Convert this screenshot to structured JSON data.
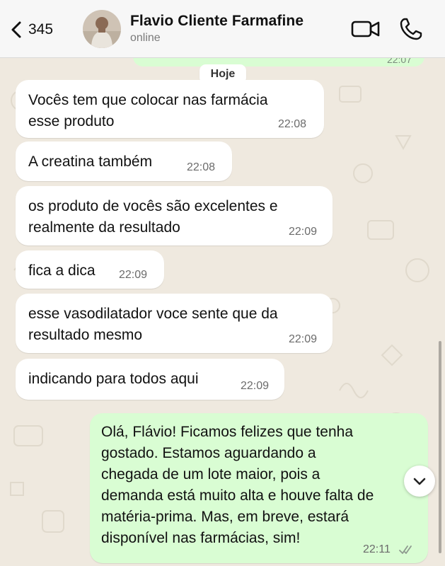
{
  "header": {
    "back_count": "345",
    "contact_name": "Flavio Cliente Farmafine",
    "status": "online",
    "icons": {
      "back": "chevron-left-icon",
      "video": "video-camera-icon",
      "phone": "phone-icon"
    }
  },
  "chat": {
    "previous_time": "22:07",
    "day_label": "Hoje",
    "messages": [
      {
        "direction": "in",
        "text": "Vocês tem que colocar nas farmácia\nesse produto",
        "time": "22:08"
      },
      {
        "direction": "in",
        "text": "A creatina também",
        "time": "22:08"
      },
      {
        "direction": "in",
        "text": "os produto de vocês são excelentes e\nrealmente da resultado",
        "time": "22:09"
      },
      {
        "direction": "in",
        "text": "fica a dica",
        "time": "22:09"
      },
      {
        "direction": "in",
        "text": "esse vasodilatador voce sente que da\nresultado mesmo",
        "time": "22:09"
      },
      {
        "direction": "in",
        "text": "indicando para todos aqui",
        "time": "22:09"
      },
      {
        "direction": "out",
        "text": "Olá, Flávio! Ficamos felizes que tenha\ngostado. Estamos aguardando a\nchegada de um lote maior, pois a\ndemanda está muito alta e houve falta de\nmatéria-prima. Mas, em breve, estará\ndisponível nas farmácias, sim!",
        "time": "22:11",
        "status": "read"
      }
    ],
    "scroll_icon": "chevron-down-icon"
  },
  "colors": {
    "incoming_bubble": "#ffffff",
    "outgoing_bubble": "#d9fdd3",
    "wallpaper": "#efe9df",
    "header": "#f7f7f7"
  }
}
